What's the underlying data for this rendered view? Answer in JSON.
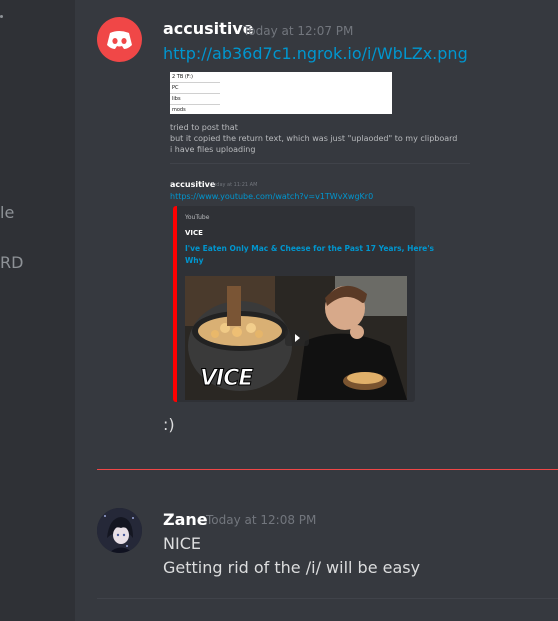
{
  "sidebar": {
    "partial_items": [
      "le",
      "RD"
    ]
  },
  "messages": [
    {
      "author": "accusitive",
      "timestamp": "Today at 12:07 PM",
      "link": "http://ab36d7c1.ngrok.io/i/WbLZx.png",
      "screenshot_lines": [
        "2 TB (F:)",
        "PC",
        "libs",
        "mods"
      ],
      "lines": [
        "tried to post that",
        "but it copied the return text, which was just \"uplaoded\" to my clipboard",
        "i have files uploading"
      ],
      "quoted": {
        "author": "accusitive",
        "timestamp": "Today at 11:21 AM",
        "link": "https://www.youtube.com/watch?v=v1TWvXwgKr0"
      },
      "embed": {
        "provider": "YouTube",
        "author": "VICE",
        "title_line1": "I've Eaten Only Mac & Cheese for the Past 17 Years, Here's",
        "title_line2": "Why",
        "watermark": "VICE"
      },
      "followup": ":)"
    },
    {
      "author": "Zane",
      "timestamp": "Today at 12:08 PM",
      "lines": [
        "NICE",
        "Getting rid of the /i/ will be easy"
      ]
    }
  ],
  "colors": {
    "background": "#36393f",
    "sidebar": "#2f3136",
    "link": "#0096cf",
    "discord_red": "#f04747",
    "embed_border": "#ff0000"
  },
  "icons": {
    "accusitive_avatar": "discord-logo-icon",
    "zane_avatar": "anime-avatar",
    "play": "play-icon"
  }
}
